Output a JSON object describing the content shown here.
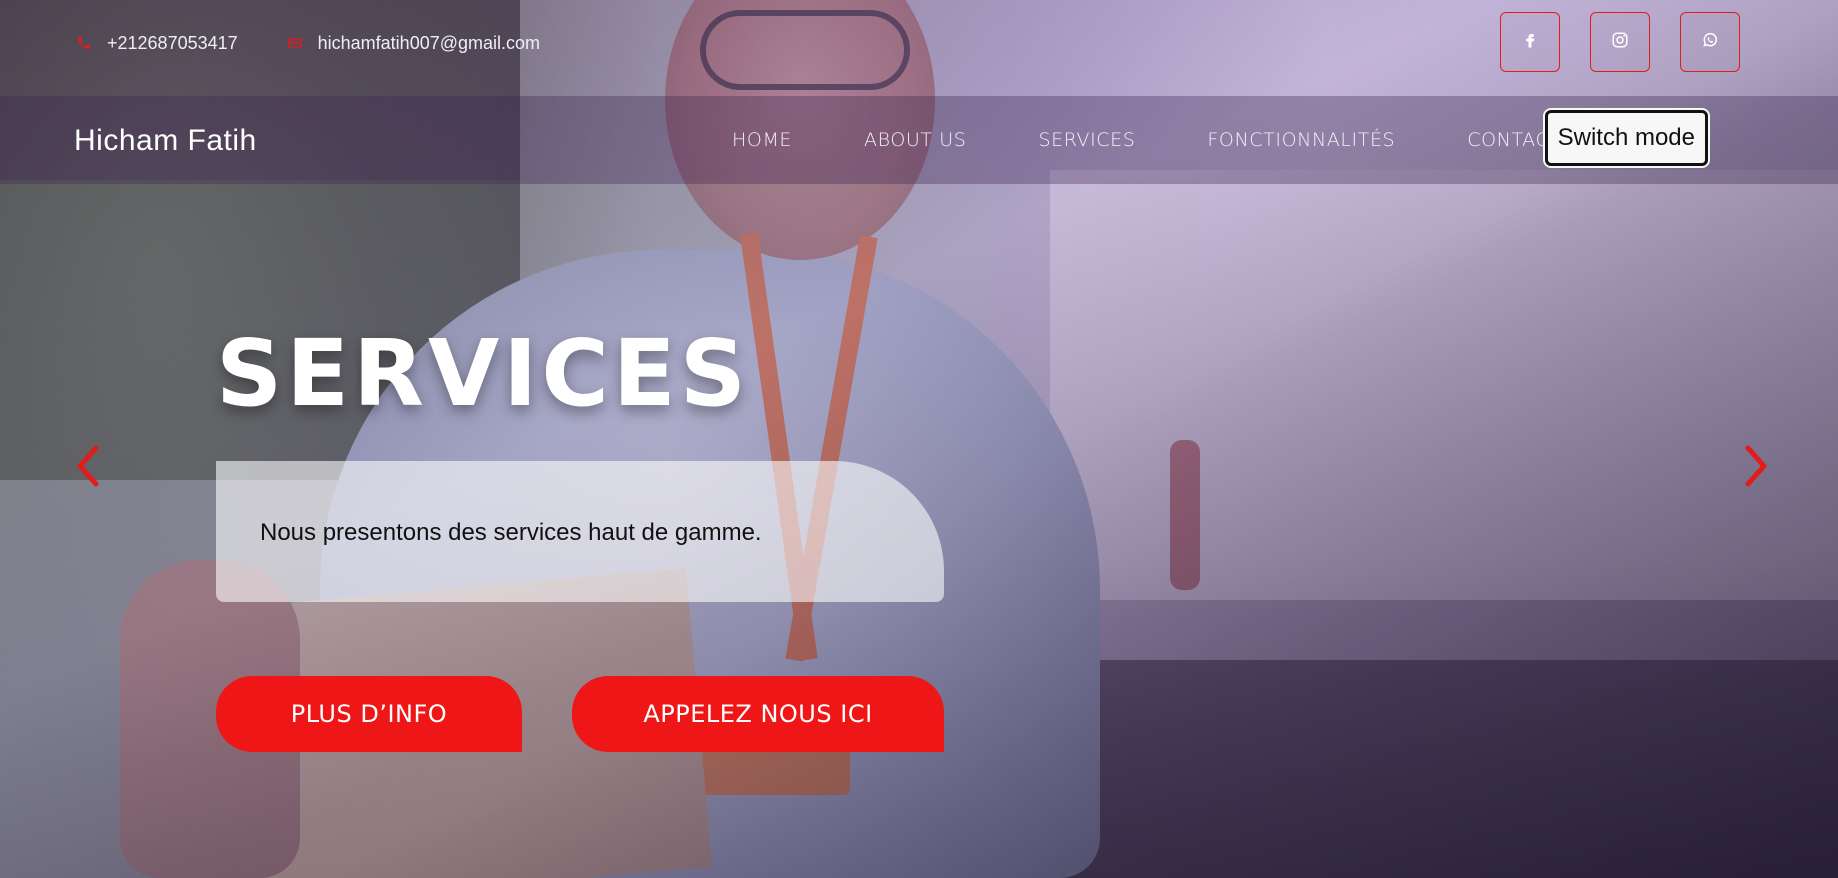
{
  "topbar": {
    "phone": "+212687053417",
    "email": "hichamfatih007@gmail.com",
    "socials": [
      {
        "name": "facebook",
        "icon": "facebook-icon"
      },
      {
        "name": "instagram",
        "icon": "instagram-icon"
      },
      {
        "name": "whatsapp",
        "icon": "whatsapp-icon"
      }
    ]
  },
  "navbar": {
    "brand": "Hicham Fatih",
    "links": [
      "HOME",
      "ABOUT US",
      "SERVICES",
      "FONCTIONNALITÉS",
      "CONTACT US"
    ],
    "switch_mode": "Switch mode"
  },
  "hero": {
    "title": "SERVICES",
    "subtitle": "Nous presentons des services haut de gamme.",
    "buttons": {
      "info": "PLUS D’INFO",
      "call": "APPELEZ NOUS ICI"
    },
    "carousel": {
      "prev_icon": "chevron-left-icon",
      "next_icon": "chevron-right-icon"
    }
  },
  "colors": {
    "accent": "#ee1616",
    "accent_border": "#e21b1b",
    "overlay": "#5a3c6e",
    "text_light": "#ffffff"
  }
}
